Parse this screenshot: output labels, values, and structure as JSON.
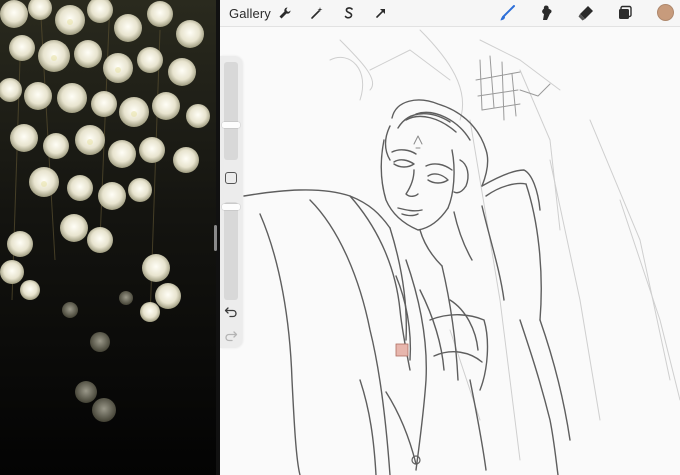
{
  "topbar": {
    "gallery_label": "Gallery",
    "icons": [
      "wrench-icon",
      "magic-wand-icon",
      "selection-icon",
      "transform-arrow-icon",
      "brush-icon",
      "smudge-icon",
      "eraser-icon",
      "layers-icon"
    ],
    "brush_color": "#c79b7c",
    "active_tool_color": "#2e6fd8"
  },
  "sidebar": {
    "icons": [
      "modify-square-icon",
      "undo-icon",
      "redo-icon"
    ]
  },
  "theme": {
    "canvas_bg": "#fafafa",
    "sketch_stroke": "#6a6a6a",
    "sketch_faint": "#c8c8c8"
  }
}
